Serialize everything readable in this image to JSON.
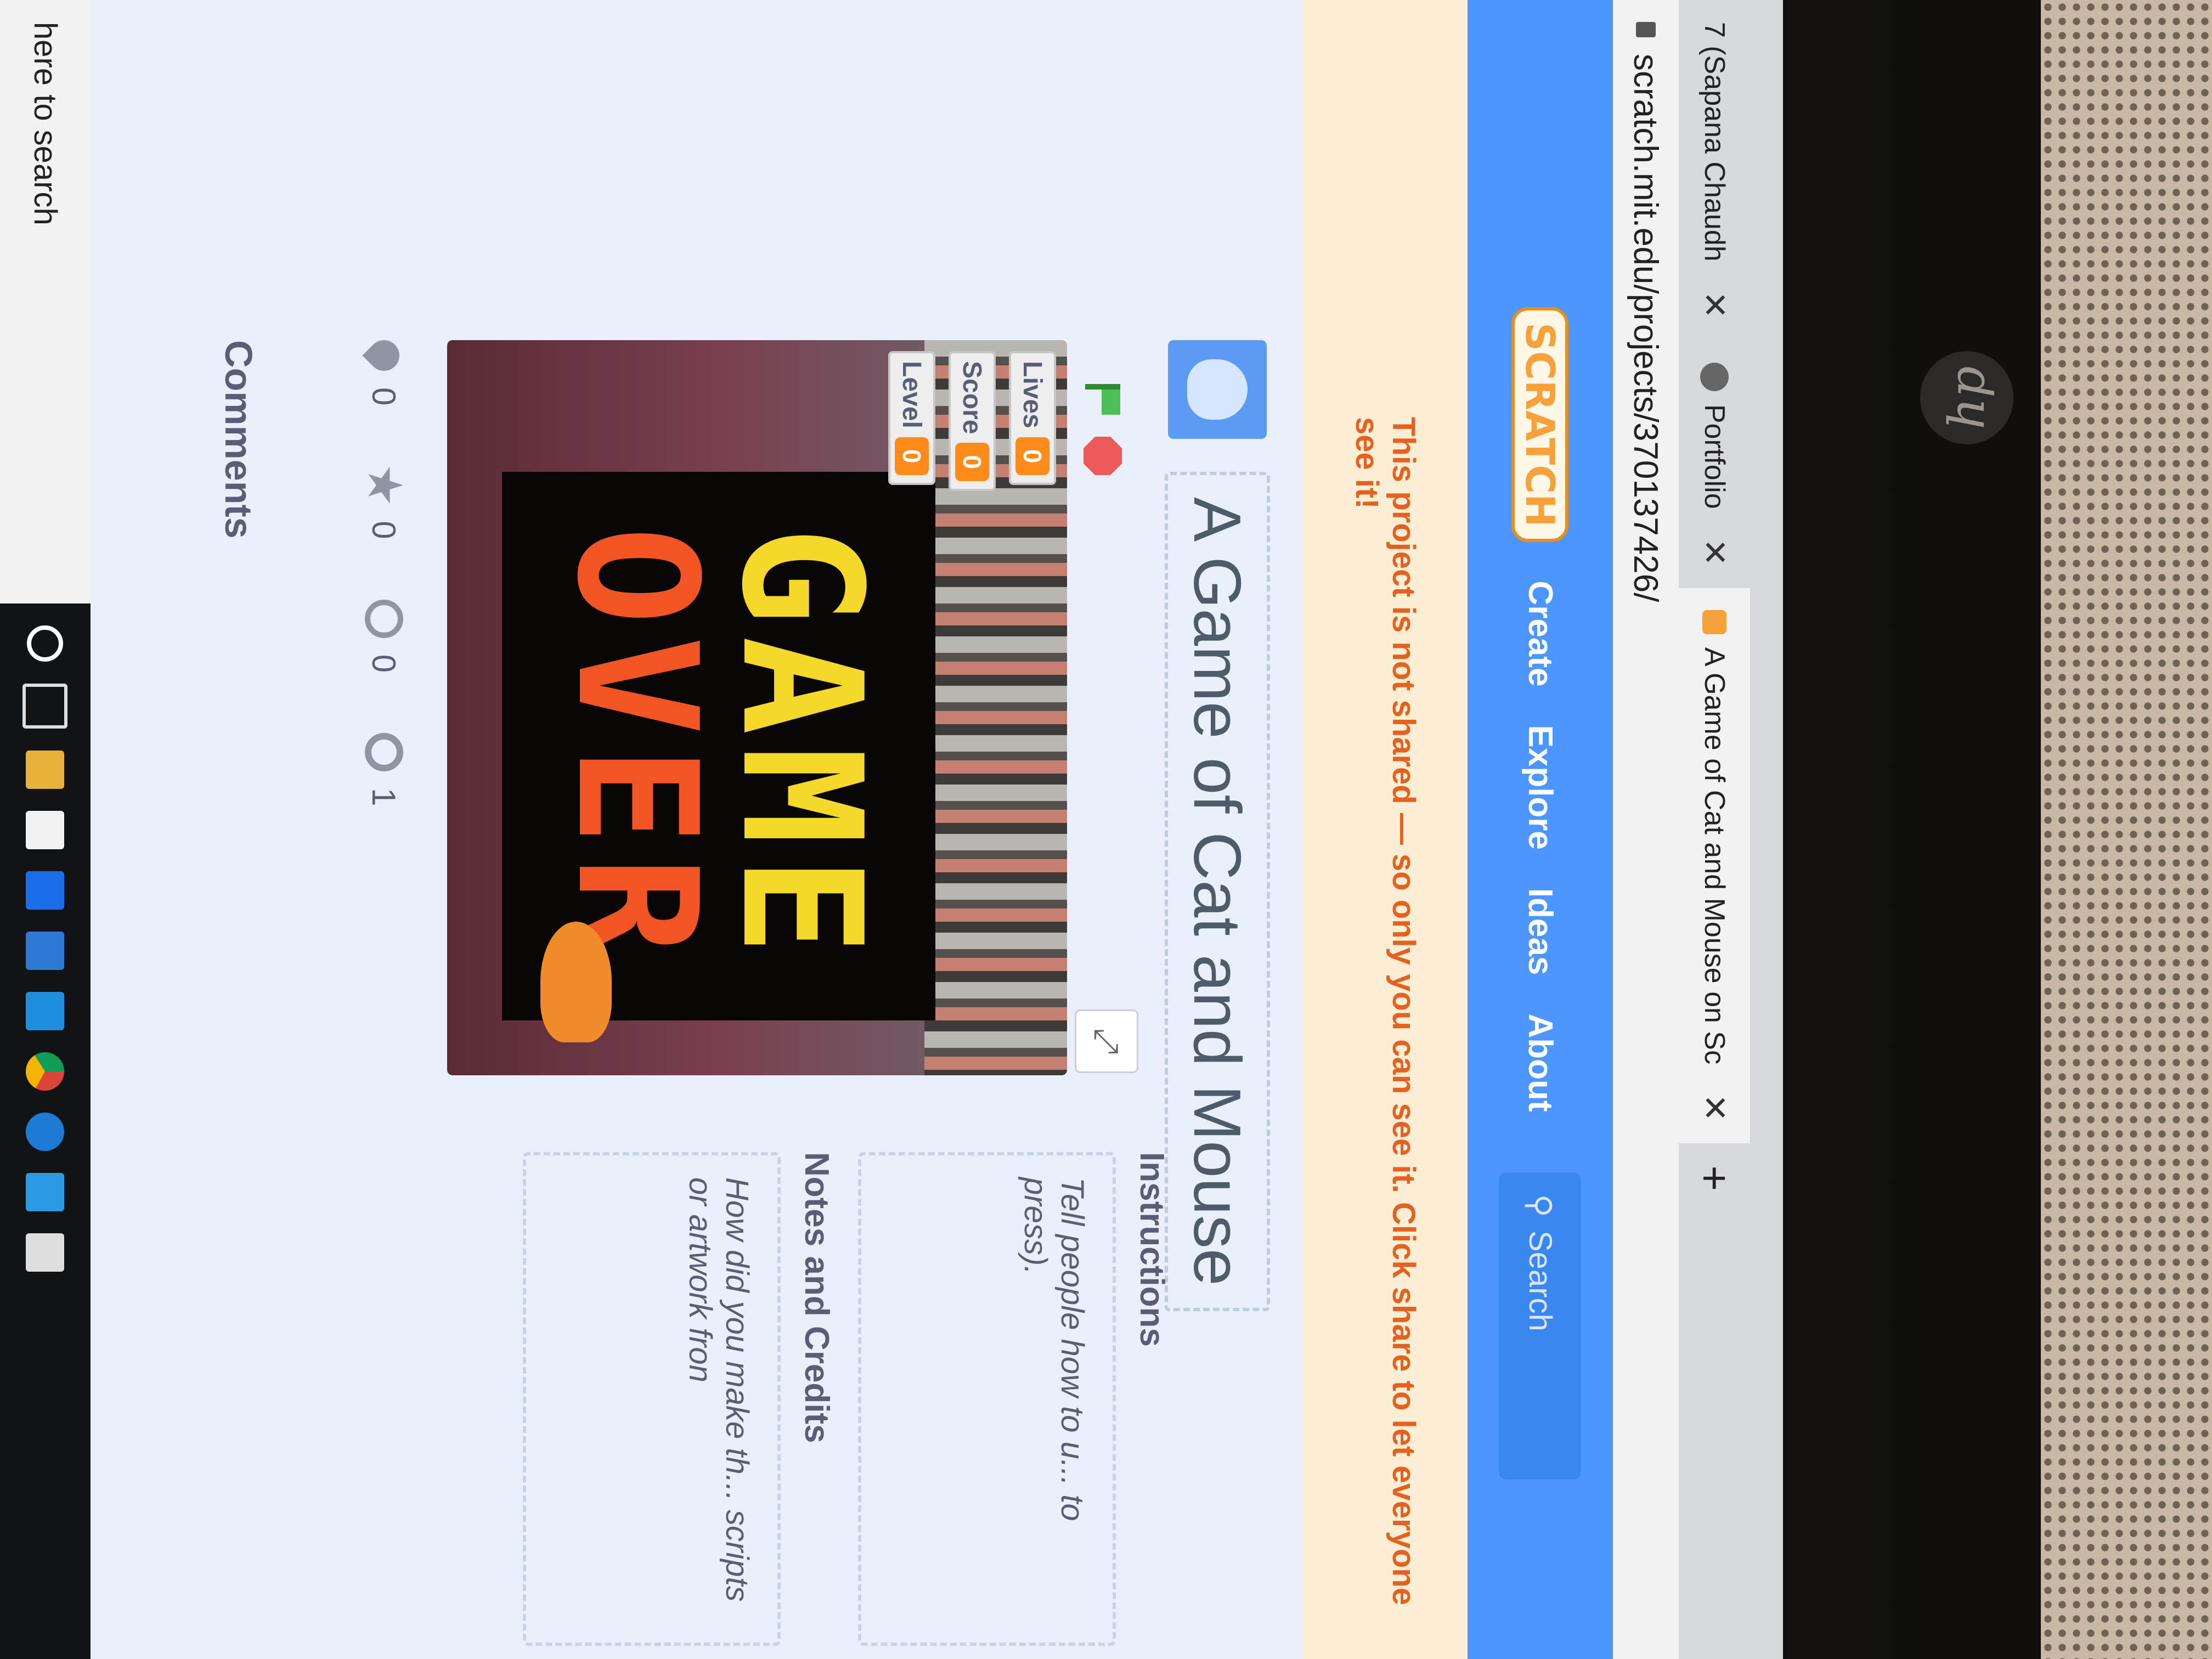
{
  "browser": {
    "tabs": [
      {
        "label": "7 (Sapana Chaudh",
        "active": false
      },
      {
        "label": "Portfolio",
        "active": false
      },
      {
        "label": "A Game of Cat and Mouse on Sc",
        "active": true
      }
    ],
    "new_tab_label": "+",
    "address": "scratch.mit.edu/projects/370137426/"
  },
  "navbar": {
    "logo": "SCRATCH",
    "links": [
      "Create",
      "Explore",
      "Ideas",
      "About"
    ],
    "search_placeholder": "Search"
  },
  "banner": {
    "text": "This project is not shared — so only you can see it. Click share to let everyone see it!"
  },
  "project": {
    "title": "A Game of Cat and Mouse",
    "monitors": [
      {
        "label": "Lives",
        "value": "0"
      },
      {
        "label": "Score",
        "value": "0"
      },
      {
        "label": "Level",
        "value": "0"
      }
    ],
    "game_over": {
      "line1": "GAME",
      "line2": "OVER"
    },
    "stats": {
      "loves": "0",
      "favorites": "0",
      "remixes": "0",
      "views": "1"
    }
  },
  "side": {
    "instructions_heading": "Instructions",
    "instructions_placeholder": "Tell people how to u... to press).",
    "notes_heading": "Notes and Credits",
    "notes_placeholder": "How did you make th... scripts or artwork fron"
  },
  "comments_heading": "Comments",
  "taskbar": {
    "search_text": "here to search"
  },
  "colors": {
    "nav_blue": "#4c97ff",
    "banner_text": "#e6611f",
    "monitor_orange": "#ff8c1a"
  }
}
